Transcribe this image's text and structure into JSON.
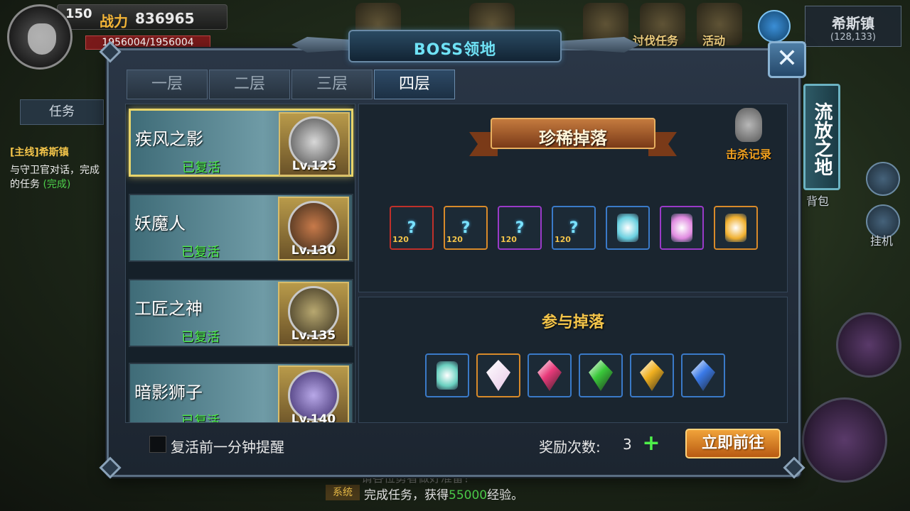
{
  "hud": {
    "level": "150",
    "power_label": "战力",
    "power_value": "836965",
    "hp": "1956004/1956004",
    "task_tab": "任务",
    "quest_title": "[主线]希斯镇",
    "quest_desc": "与守卫官对话，完成",
    "quest_desc2": "的任务",
    "quest_done": "(完成)",
    "top_labels": [
      "讨伐任务",
      "活动"
    ],
    "location_name": "希斯镇",
    "location_coord": "(128,133)",
    "side_labels": [
      "背包",
      "挂机"
    ],
    "system_tag": "系统",
    "system_msg_pre": "完成任务，获得",
    "system_msg_num": "55000",
    "system_msg_post": "经验。",
    "blur_msg": "请各位勇者做好准备！"
  },
  "dialog": {
    "title": "BOSS领地",
    "close_label": "✕",
    "tabs": [
      {
        "label": "一层"
      },
      {
        "label": "二层"
      },
      {
        "label": "三层"
      },
      {
        "label": "四层"
      }
    ],
    "active_tab": 3,
    "side_tab": "流放之地"
  },
  "bosses": [
    {
      "name": "疾风之影",
      "status": "已复活",
      "level": "Lv.125"
    },
    {
      "name": "妖魔人",
      "status": "已复活",
      "level": "Lv.130"
    },
    {
      "name": "工匠之神",
      "status": "已复活",
      "level": "Lv.135"
    },
    {
      "name": "暗影狮子",
      "status": "已复活",
      "level": "Lv.140"
    }
  ],
  "rare_drops": {
    "title": "珍稀掉落",
    "kill_record": "击杀记录",
    "items": [
      {
        "type": "mystery-armor",
        "level": "120",
        "border": "#c0302a"
      },
      {
        "type": "mystery-armor",
        "level": "120",
        "border": "#d88a2a"
      },
      {
        "type": "mystery-armor",
        "level": "120",
        "border": "#9a3ac8"
      },
      {
        "type": "mystery-armor",
        "level": "120",
        "border": "#3a7ac8"
      },
      {
        "type": "jar",
        "color": "#6ad0e0",
        "border": "#3a7ac8"
      },
      {
        "type": "jar",
        "color": "#e08ae0",
        "border": "#9a3ac8"
      },
      {
        "type": "jar",
        "color": "#f0b030",
        "border": "#d88a2a"
      }
    ]
  },
  "participation_drops": {
    "title": "参与掉落",
    "items": [
      {
        "type": "jar",
        "color": "#6ad0c0",
        "border": "#3a7ac8"
      },
      {
        "type": "crystal",
        "color": "#e8c8e8",
        "border": "#d88a2a"
      },
      {
        "type": "gem",
        "color": "#e83a7a",
        "border": "#3a7ac8"
      },
      {
        "type": "gem",
        "color": "#3ac83a",
        "border": "#3a7ac8"
      },
      {
        "type": "gem",
        "color": "#f0b020",
        "border": "#3a7ac8"
      },
      {
        "type": "gem",
        "color": "#3a7ae8",
        "border": "#3a7ac8"
      }
    ]
  },
  "footer": {
    "remind_label": "复活前一分钟提醒",
    "reward_label": "奖励次数:",
    "reward_count": "3",
    "plus_label": "+",
    "go_button": "立即前往"
  }
}
